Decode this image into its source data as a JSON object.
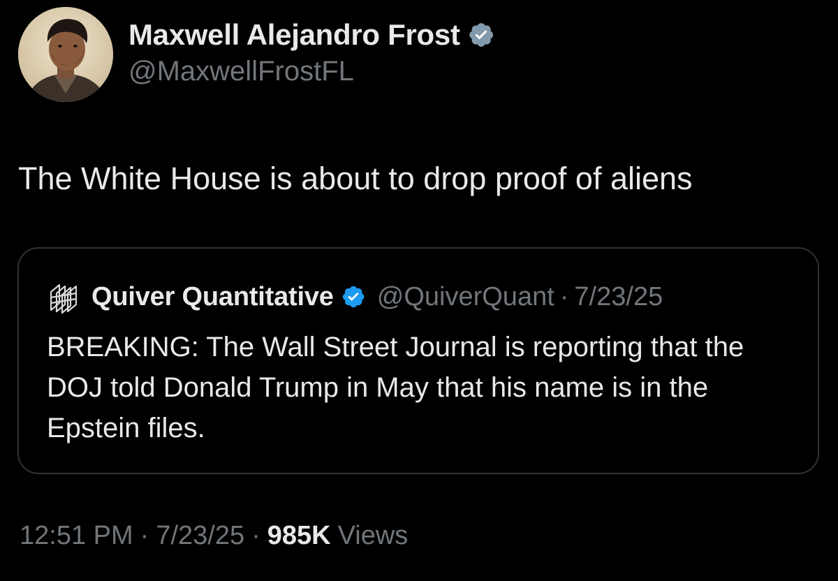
{
  "author": {
    "name": "Maxwell Alejandro Frost",
    "handle": "@MaxwellFrostFL",
    "verified": true,
    "avatar_icon": "user-avatar-photo"
  },
  "tweet": {
    "text": "The White House is about to drop proof of aliens"
  },
  "quote": {
    "name": "Quiver Quantitative",
    "handle": "@QuiverQuant",
    "separator": "·",
    "date": "7/23/25",
    "verified": true,
    "logo_icon": "quiver-logo-icon",
    "text": "BREAKING: The Wall Street Journal is reporting that the DOJ told Donald Trump in May that his name is in the Epstein files."
  },
  "meta": {
    "time": "12:51 PM",
    "separator": "·",
    "date": "7/23/25",
    "views_count": "985K",
    "views_label": "Views"
  },
  "colors": {
    "background": "#000000",
    "primary_text": "#e7e9ea",
    "secondary_text": "#71767b",
    "verified_blue": "#1d9bf0",
    "verified_gray": "#829aab",
    "border": "#2f3336"
  }
}
